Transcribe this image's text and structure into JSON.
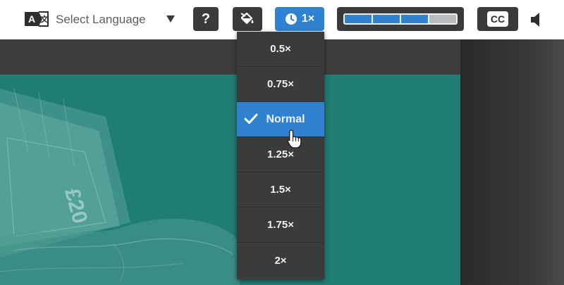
{
  "toolbar": {
    "language": {
      "icon": "translate-icon",
      "label": "Select Language",
      "caret_icon": "caret-down-icon"
    },
    "help_label": "?",
    "theme_icon": "paint-bucket-icon",
    "speed": {
      "icon": "clock-icon",
      "label": "1×",
      "accent": "#2f82d0"
    },
    "progress": {
      "segments_total": 4,
      "segments_filled": 3,
      "fill_color": "#2f82d0"
    },
    "cc_label": "CC",
    "volume_icon": "speaker-icon"
  },
  "speed_menu": {
    "items": [
      {
        "label": "0.5×"
      },
      {
        "label": "0.75×"
      },
      {
        "label": "Normal",
        "selected": true
      },
      {
        "label": "1.25×"
      },
      {
        "label": "1.5×"
      },
      {
        "label": "1.75×"
      },
      {
        "label": "2×"
      }
    ],
    "selected_icon": "checkmark-icon"
  },
  "slide": {
    "background_color": "#1f7d74",
    "image_description_icon": "banknotes-in-hand-image",
    "banknote_text": "£20"
  }
}
